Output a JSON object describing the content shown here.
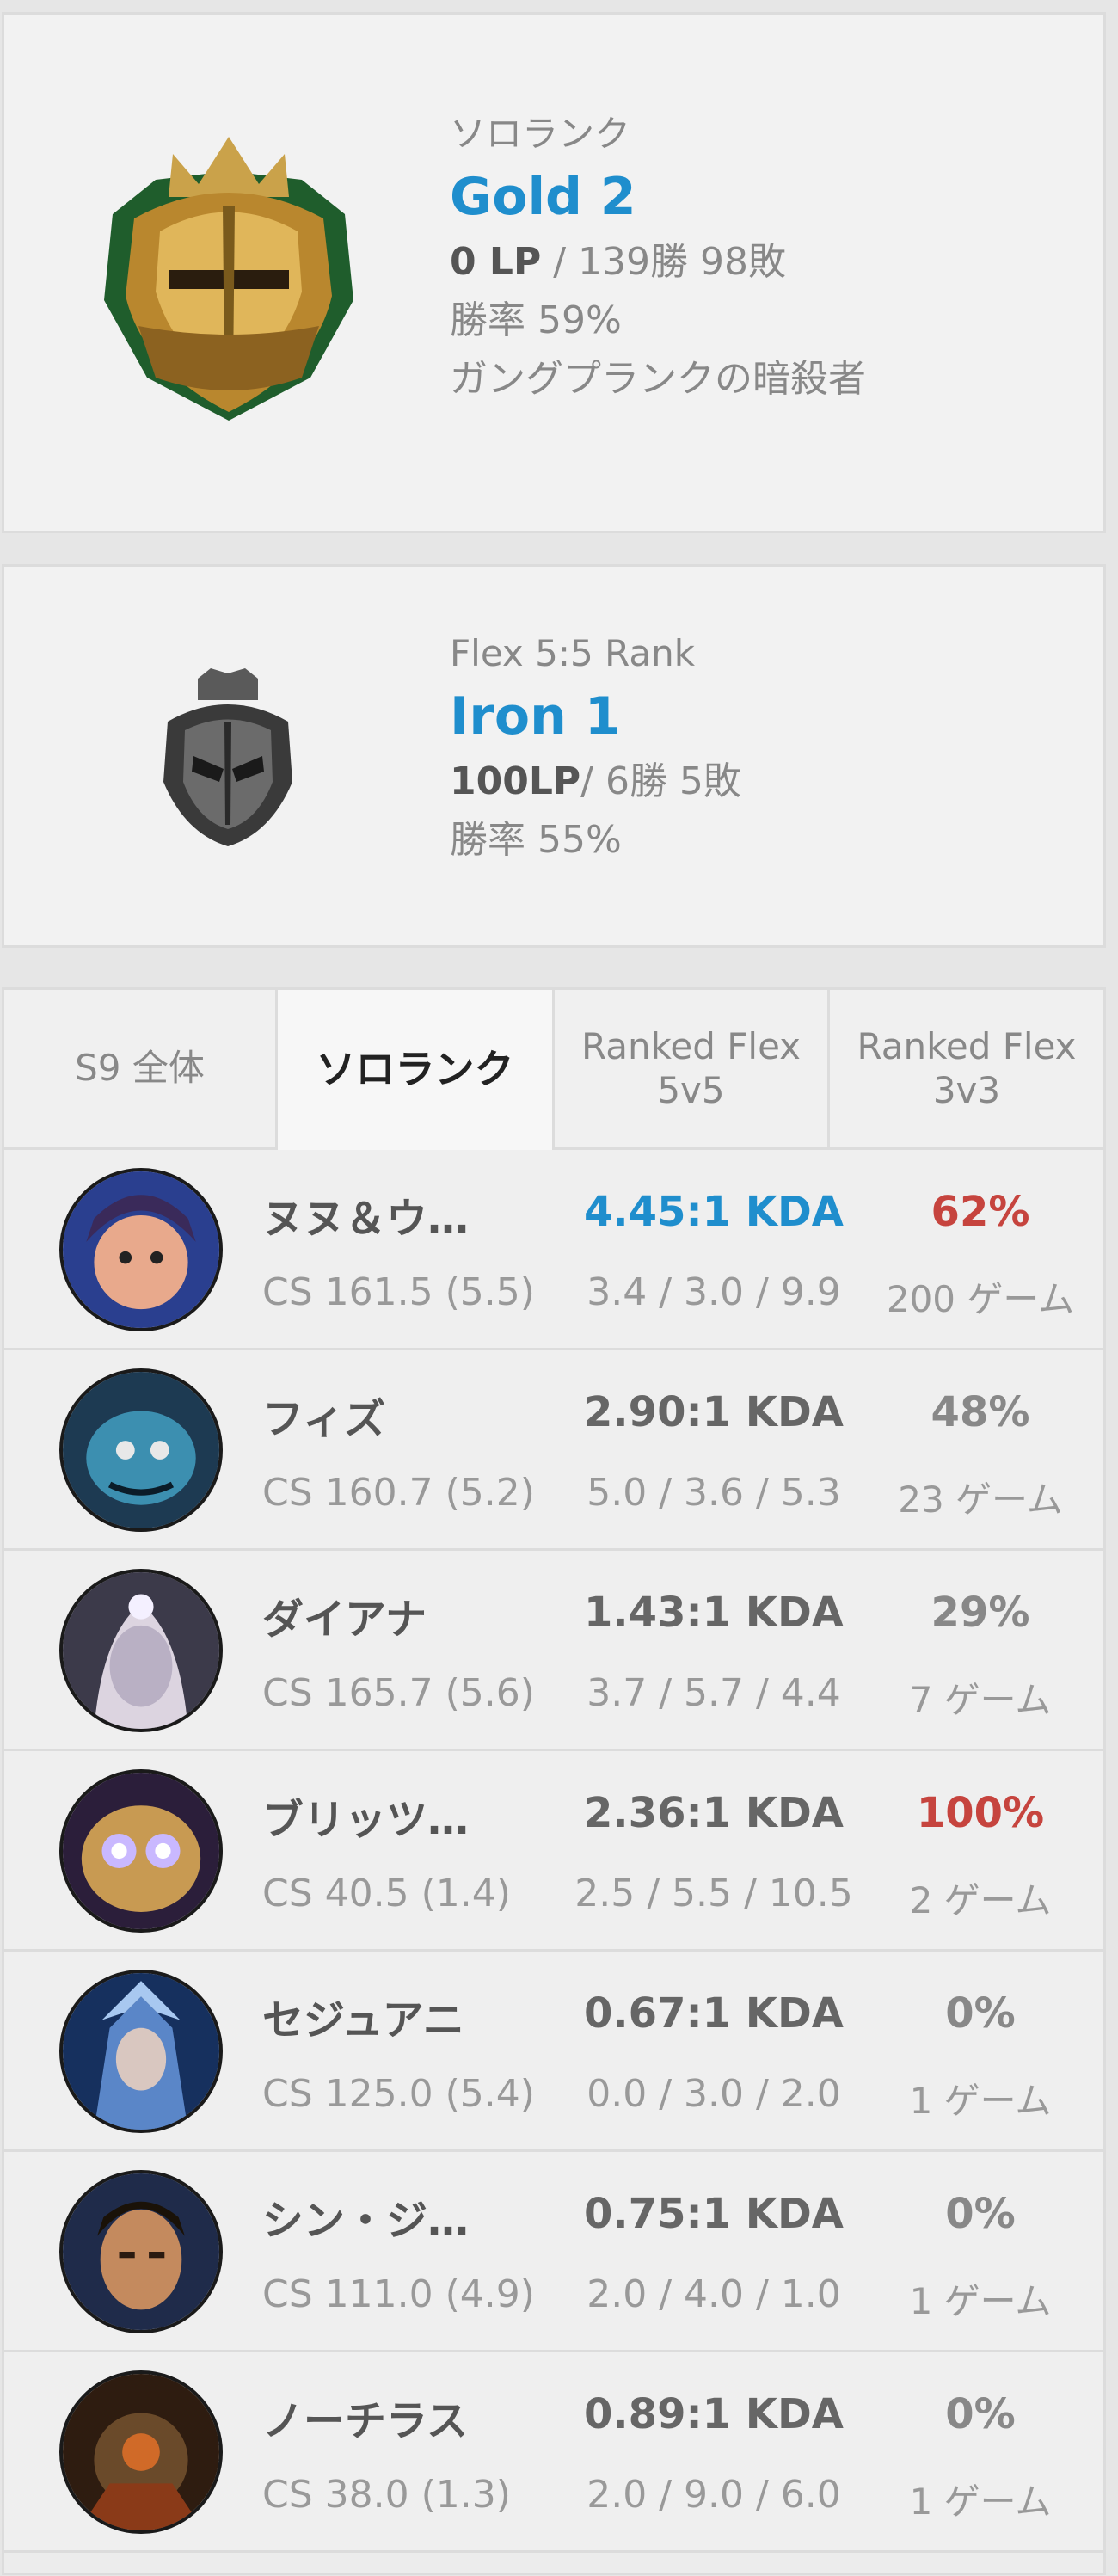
{
  "solo_rank": {
    "queue": "ソロランク",
    "tier": "Gold 2",
    "lp": "0 LP",
    "record": " / 139勝 98敗",
    "winrate": "勝率 59%",
    "league_name": "ガングプランクの暗殺者",
    "emblem_icon": "gold-emblem-icon"
  },
  "flex_rank": {
    "queue": "Flex 5:5 Rank",
    "tier": "Iron 1",
    "lp": "100LP",
    "record": "/ 6勝 5敗",
    "winrate": "勝率 55%",
    "emblem_icon": "iron-emblem-icon"
  },
  "tabs": [
    {
      "label": "S9 全体"
    },
    {
      "label": "ソロランク"
    },
    {
      "label": "Ranked Flex\n5v5"
    },
    {
      "label": "Ranked Flex\n3v3"
    }
  ],
  "active_tab": "ソロランク",
  "champions": [
    {
      "name": "ヌヌ＆ウ…",
      "cs": "CS 161.5 (5.5)",
      "kda": "4.45:1 KDA",
      "kda_detail": "3.4 / 3.0 / 9.9",
      "winrate": "62%",
      "games": "200 ゲーム",
      "kda_color": "#1f8ecd",
      "winrate_color": "#c6443e"
    },
    {
      "name": "フィズ",
      "cs": "CS 160.7 (5.2)",
      "kda": "2.90:1 KDA",
      "kda_detail": "5.0 / 3.6 / 5.3",
      "winrate": "48%",
      "games": "23 ゲーム"
    },
    {
      "name": "ダイアナ",
      "cs": "CS 165.7 (5.6)",
      "kda": "1.43:1 KDA",
      "kda_detail": "3.7 / 5.7 / 4.4",
      "winrate": "29%",
      "games": "7 ゲーム"
    },
    {
      "name": "ブリッツ…",
      "cs": "CS 40.5 (1.4)",
      "kda": "2.36:1 KDA",
      "kda_detail": "2.5 / 5.5 / 10.5",
      "winrate": "100%",
      "games": "2 ゲーム",
      "winrate_color": "#c6443e"
    },
    {
      "name": "セジュアニ",
      "cs": "CS 125.0 (5.4)",
      "kda": "0.67:1 KDA",
      "kda_detail": "0.0 / 3.0 / 2.0",
      "winrate": "0%",
      "games": "1 ゲーム"
    },
    {
      "name": "シン・ジ…",
      "cs": "CS 111.0 (4.9)",
      "kda": "0.75:1 KDA",
      "kda_detail": "2.0 / 4.0 / 1.0",
      "winrate": "0%",
      "games": "1 ゲーム"
    },
    {
      "name": "ノーチラス",
      "cs": "CS 38.0 (1.3)",
      "kda": "0.89:1 KDA",
      "kda_detail": "2.0 / 9.0 / 6.0",
      "winrate": "0%",
      "games": "1 ゲーム"
    }
  ]
}
